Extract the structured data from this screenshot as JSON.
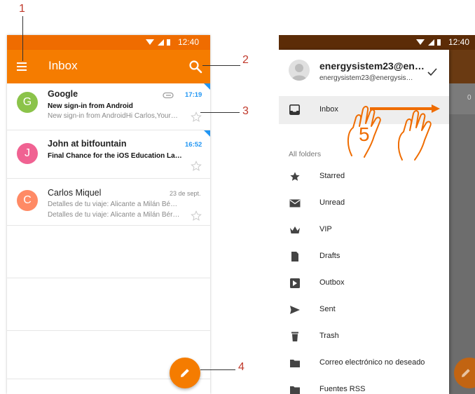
{
  "annotations": {
    "n1": "1",
    "n2": "2",
    "n3": "3",
    "n4": "4"
  },
  "left_phone": {
    "status_time": "12:40",
    "title": "Inbox",
    "emails": [
      {
        "initial": "G",
        "avatar_color": "#8bc34a",
        "sender": "Google",
        "time": "17:19",
        "subject": "New sign-in from Android",
        "preview": "New sign-in from AndroidHi Carlos,Your…",
        "unread": true,
        "has_attachment": true
      },
      {
        "initial": "J",
        "avatar_color": "#f06292",
        "sender": "John at bitfountain",
        "time": "16:52",
        "subject": "Final Chance for the iOS Education La…",
        "preview": "",
        "unread": true,
        "has_attachment": false
      },
      {
        "initial": "C",
        "avatar_color": "#ff8a65",
        "sender": "Carlos Miquel",
        "time": "23 de sept.",
        "subject": "Detalles de tu viaje: Alicante a Milán Bé…",
        "preview": "Detalles de tu viaje: Alicante a Milán Bér…",
        "unread": false,
        "has_attachment": false
      }
    ],
    "fab_icon": "pencil-icon"
  },
  "right_phone": {
    "status_time": "12:40",
    "account_name": "energysistem23@en…",
    "account_email": "energysistem23@energysis…",
    "inbox_label": "Inbox",
    "all_folders_label": "All folders",
    "folders": [
      {
        "label": "Starred",
        "icon": "star-icon"
      },
      {
        "label": "Unread",
        "icon": "envelope-icon"
      },
      {
        "label": "VIP",
        "icon": "crown-icon"
      },
      {
        "label": "Drafts",
        "icon": "draft-icon"
      },
      {
        "label": "Outbox",
        "icon": "outbox-icon"
      },
      {
        "label": "Sent",
        "icon": "send-icon"
      },
      {
        "label": "Trash",
        "icon": "trash-icon"
      },
      {
        "label": "Correo electrónico no deseado",
        "icon": "folder-icon"
      },
      {
        "label": "Fuentes RSS",
        "icon": "folder-icon"
      }
    ],
    "behind_tab": "0",
    "gesture_step": "5"
  },
  "colors": {
    "accent": "#f57c00",
    "unread_time": "#2196f3",
    "annotation": "#c0392b"
  }
}
